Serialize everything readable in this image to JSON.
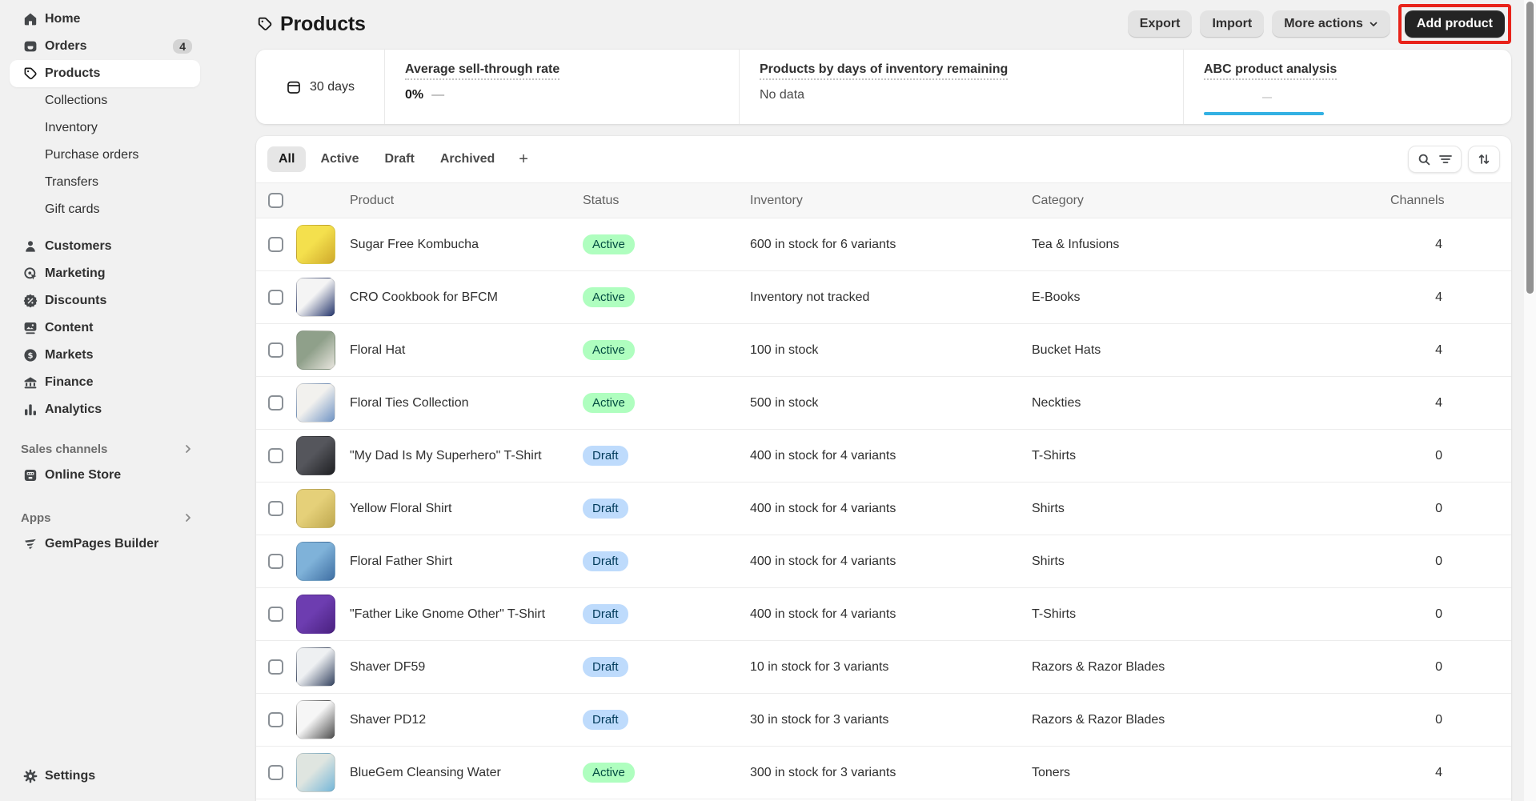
{
  "sidebar": {
    "home": "Home",
    "orders": "Orders",
    "orders_badge": "4",
    "products": "Products",
    "collections": "Collections",
    "inventory": "Inventory",
    "purchase_orders": "Purchase orders",
    "transfers": "Transfers",
    "gift_cards": "Gift cards",
    "customers": "Customers",
    "marketing": "Marketing",
    "discounts": "Discounts",
    "content": "Content",
    "markets": "Markets",
    "finance": "Finance",
    "analytics": "Analytics",
    "sales_channels_label": "Sales channels",
    "online_store": "Online Store",
    "apps_label": "Apps",
    "gempages": "GemPages Builder",
    "settings": "Settings"
  },
  "header": {
    "title": "Products",
    "export": "Export",
    "import": "Import",
    "more_actions": "More actions",
    "add_product": "Add product"
  },
  "metrics": {
    "range": "30 days",
    "sell_through": {
      "title": "Average sell-through rate",
      "value": "0%",
      "dash": "—"
    },
    "days_remaining": {
      "title": "Products by days of inventory remaining",
      "value": "No data"
    },
    "abc": {
      "title": "ABC product analysis"
    }
  },
  "tabs": {
    "all": "All",
    "active": "Active",
    "draft": "Draft",
    "archived": "Archived",
    "plus": "+"
  },
  "table": {
    "columns": {
      "product": "Product",
      "status": "Status",
      "inventory": "Inventory",
      "category": "Category",
      "channels": "Channels"
    },
    "rows": [
      {
        "name": "Sugar Free Kombucha",
        "status": "Active",
        "inventory": "600 in stock for 6 variants",
        "category": "Tea & Infusions",
        "channels": "4",
        "thumb": {
          "c1": "#f4e04d",
          "c2": "#cfa92b"
        }
      },
      {
        "name": "CRO Cookbook for BFCM",
        "status": "Active",
        "inventory": "Inventory not tracked",
        "category": "E-Books",
        "channels": "4",
        "thumb": {
          "c1": "#f4f4f4",
          "c2": "#24346b"
        }
      },
      {
        "name": "Floral Hat",
        "status": "Active",
        "inventory": "100 in stock",
        "category": "Bucket Hats",
        "channels": "4",
        "thumb": {
          "c1": "#8fa08a",
          "c2": "#e9e6df"
        }
      },
      {
        "name": "Floral Ties Collection",
        "status": "Active",
        "inventory": "500 in stock",
        "category": "Neckties",
        "channels": "4",
        "thumb": {
          "c1": "#f2f1ee",
          "c2": "#6f93c4"
        }
      },
      {
        "name": "\"My Dad Is My Superhero\" T-Shirt",
        "status": "Draft",
        "inventory": "400 in stock for 4 variants",
        "category": "T-Shirts",
        "channels": "0",
        "thumb": {
          "c1": "#55565c",
          "c2": "#1f2023"
        }
      },
      {
        "name": "Yellow Floral Shirt",
        "status": "Draft",
        "inventory": "400 in stock for 4 variants",
        "category": "Shirts",
        "channels": "0",
        "thumb": {
          "c1": "#e5d079",
          "c2": "#bfa84f"
        }
      },
      {
        "name": "Floral Father Shirt",
        "status": "Draft",
        "inventory": "400 in stock for 4 variants",
        "category": "Shirts",
        "channels": "0",
        "thumb": {
          "c1": "#7fb2d9",
          "c2": "#3f6fa3"
        }
      },
      {
        "name": "\"Father Like Gnome Other\" T-Shirt",
        "status": "Draft",
        "inventory": "400 in stock for 4 variants",
        "category": "T-Shirts",
        "channels": "0",
        "thumb": {
          "c1": "#6d3db0",
          "c2": "#4a2180"
        }
      },
      {
        "name": "Shaver DF59",
        "status": "Draft",
        "inventory": "10 in stock for 3 variants",
        "category": "Razors & Razor Blades",
        "channels": "0",
        "thumb": {
          "c1": "#eef0f2",
          "c2": "#33415e"
        }
      },
      {
        "name": "Shaver PD12",
        "status": "Draft",
        "inventory": "30 in stock for 3 variants",
        "category": "Razors & Razor Blades",
        "channels": "0",
        "thumb": {
          "c1": "#f6f6f6",
          "c2": "#4a4a4a"
        }
      },
      {
        "name": "BlueGem Cleansing Water",
        "status": "Active",
        "inventory": "300 in stock for 3 variants",
        "category": "Toners",
        "channels": "4",
        "thumb": {
          "c1": "#dfe5e0",
          "c2": "#74b6d8"
        }
      }
    ]
  },
  "colors": {
    "active_badge_bg": "#affebf",
    "active_badge_text": "#014b40",
    "draft_badge_bg": "#bedbfc",
    "draft_badge_text": "#003a5a",
    "abc_line": "#33b1e3",
    "annotation_red": "#e8231a",
    "accent_dark_button": "#242424"
  },
  "icons": {
    "search-icon": "⌕",
    "sort-icon": "↑↓",
    "chevron-down-icon": "▾",
    "chevron-right-icon": "›",
    "plus-icon": "+",
    "calendar-icon": "▤",
    "tag-icon": "🏷",
    "gear-icon": "⚙"
  }
}
